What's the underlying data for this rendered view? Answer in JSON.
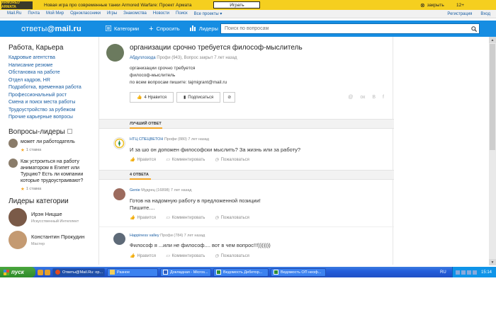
{
  "ad": {
    "logo": "ARMORED ARMATA",
    "text": "Новая игра про современные танки Armored Warfare: Проект Армата",
    "play": "Играть",
    "close": "закрыть",
    "age": "12+"
  },
  "topnav": {
    "left": [
      "Mail.Ru",
      "Почта",
      "Мой Мир",
      "Одноклассники",
      "Игры",
      "Знакомства",
      "Новости",
      "Поиск",
      "Все проекты ▾"
    ],
    "right": [
      "Регистрация",
      "Вход"
    ]
  },
  "header": {
    "brand_prefix": "ответы",
    "brand_suffix": "@mail.ru",
    "categories": "Категории",
    "ask": "Спросить",
    "leaders": "Лидеры",
    "search_placeholder": "Поиск по вопросам"
  },
  "left": {
    "section_title": "Работа, Карьера",
    "links": [
      "Кадровые агентства",
      "Написание резюме",
      "Обстановка на работе",
      "Отдел кадров, HR",
      "Подработка, временная работа",
      "Профессиональный рост",
      "Смена и поиск места работы",
      "Трудоустройство за рубежом",
      "Прочие карьерные вопросы"
    ],
    "leaders_q_title": "Вопросы-лидеры",
    "leader_questions": [
      {
        "text": "может ли работодатель",
        "stars": "1 ставка"
      },
      {
        "text": "Как устроиться на работу аниматором в Египет или Турцию? Есть ли компании которые трудоустраивают?",
        "stars": "1 ставка"
      }
    ],
    "cat_leaders_title": "Лидеры категории",
    "leaders": [
      {
        "name": "Ирэн Ницше",
        "rank": "Искусственный Интеллект"
      },
      {
        "name": "Константин Прокудин",
        "rank": "Мастер"
      }
    ]
  },
  "question": {
    "title": "организации срочно требуется философ-мыслитель",
    "author": "Абдуллозода",
    "meta": "Профи (943), Вопрос закрыт 7 лет назад",
    "body": [
      "организации срочно требуется",
      "философ-мыслитель",
      "по всем вопросам пишите: tajmigrant@mail.ru"
    ],
    "like": "4 Нравится",
    "subscribe": "Подписаться",
    "share": [
      "@",
      "ок",
      "В",
      "f"
    ]
  },
  "best": {
    "section": "ЛУЧШИЙ ОТВЕТ",
    "author": "НТЦ СПЕЦВЕТОН",
    "meta": "Профи (880) 7 лет назад",
    "text": "И за шо он допожен философски мыслить? За жизнь или за работу?"
  },
  "answers_section": "4 ОТВЕТА",
  "answers": [
    {
      "author": "Genie",
      "meta": "Мудрец (16898) 7 лет назад",
      "lines": [
        "Готов на надомную работу в предложенной позиции!",
        "Пишите...."
      ]
    },
    {
      "author": "Happiness valley",
      "meta": "Профи (784) 7 лет назад",
      "lines": [
        "Философ я ...или не философ.... вот в чем вопрос!!!)))))))"
      ]
    }
  ],
  "actions": {
    "like": "Нравится",
    "comment": "Комментировать",
    "report": "Пожаловаться"
  },
  "taskbar": {
    "start": "пуск",
    "tasks": [
      "Ответы@Mail.Ru: ор...",
      "Разное",
      "Докладная - Micros...",
      "Ведомость Дебетор...",
      "Ведомость ОП неоф..."
    ],
    "lang": "RU",
    "clock": "15:14"
  }
}
